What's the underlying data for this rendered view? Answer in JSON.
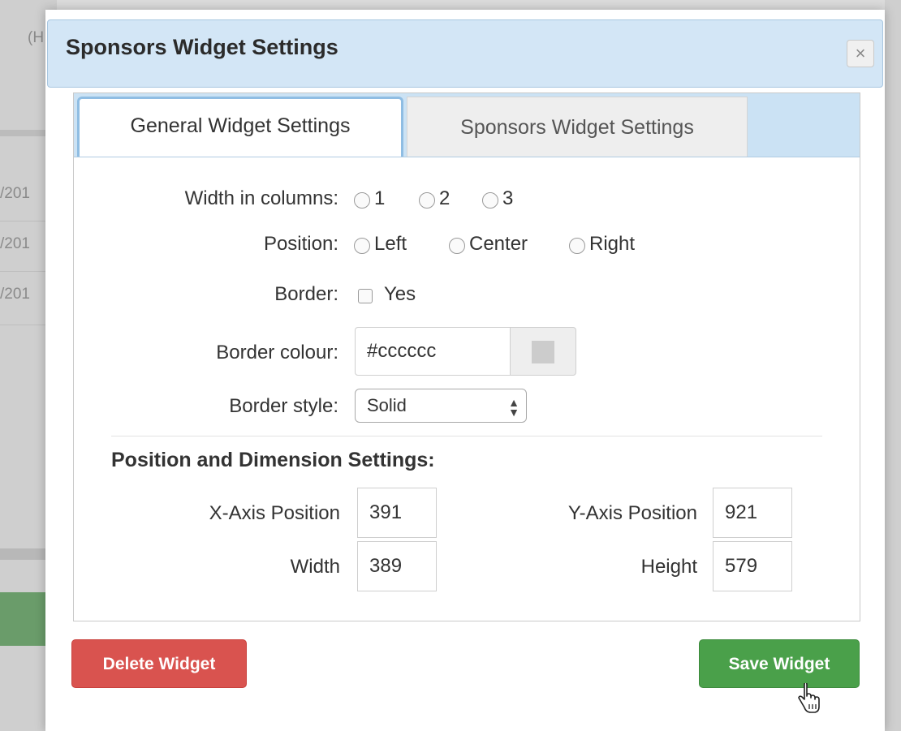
{
  "background": {
    "header_fragment": "(H",
    "rows": [
      "/201",
      "/201",
      "/201"
    ]
  },
  "modal": {
    "title": "Sponsors Widget Settings",
    "close_glyph": "×"
  },
  "tabs": [
    {
      "label": "General Widget Settings",
      "active": true
    },
    {
      "label": "Sponsors Widget Settings",
      "active": false
    }
  ],
  "form": {
    "width_label": "Width in columns:",
    "width_options": [
      "1",
      "2",
      "3"
    ],
    "position_label": "Position:",
    "position_options": [
      "Left",
      "Center",
      "Right"
    ],
    "border_label": "Border:",
    "border_option": "Yes",
    "border_colour_label": "Border colour:",
    "border_colour_value": "#cccccc",
    "border_style_label": "Border style:",
    "border_style_value": "Solid"
  },
  "dimensions": {
    "section_title": "Position and Dimension Settings:",
    "x_label": "X-Axis Position",
    "x_value": "391",
    "y_label": "Y-Axis Position",
    "y_value": "921",
    "width_label": "Width",
    "width_value": "389",
    "height_label": "Height",
    "height_value": "579"
  },
  "buttons": {
    "delete": "Delete Widget",
    "save": "Save Widget"
  },
  "colors": {
    "header_bg": "#d3e6f6",
    "tabbar_bg": "#cbe2f4",
    "delete_red": "#d9534f",
    "save_green": "#4aa04a",
    "swatch": "#cccccc"
  }
}
